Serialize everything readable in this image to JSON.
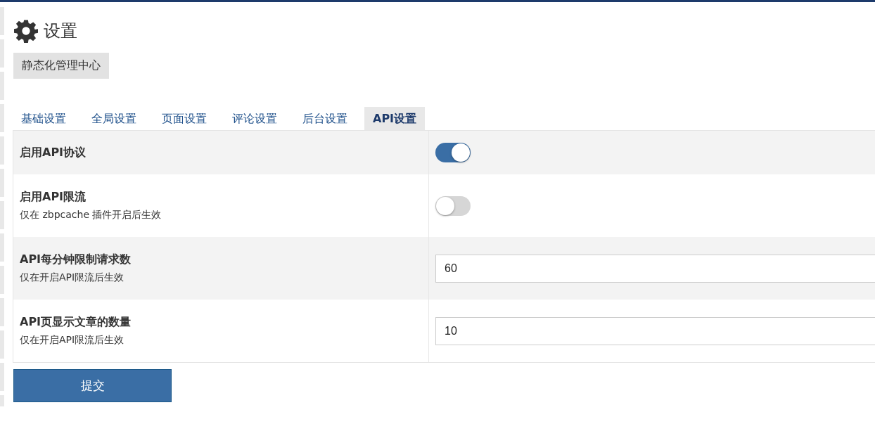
{
  "page": {
    "title": "设置",
    "action_button": "静态化管理中心"
  },
  "tabs": [
    {
      "label": "基础设置",
      "selected": false
    },
    {
      "label": "全局设置",
      "selected": false
    },
    {
      "label": "页面设置",
      "selected": false
    },
    {
      "label": "评论设置",
      "selected": false
    },
    {
      "label": "后台设置",
      "selected": false
    },
    {
      "label": "API设置",
      "selected": true
    }
  ],
  "settings": [
    {
      "kind": "toggle",
      "label": "启用API协议",
      "on": true
    },
    {
      "kind": "toggle",
      "label": "启用API限流",
      "hint": "仅在 zbpcache 插件开启后生效",
      "on": false
    },
    {
      "kind": "input",
      "label": "API每分钟限制请求数",
      "hint": "仅在开启API限流后生效",
      "value": "60"
    },
    {
      "kind": "input",
      "label": "API页显示文章的数量",
      "hint": "仅在开启API限流后生效",
      "value": "10"
    }
  ],
  "submit_button": "提交"
}
